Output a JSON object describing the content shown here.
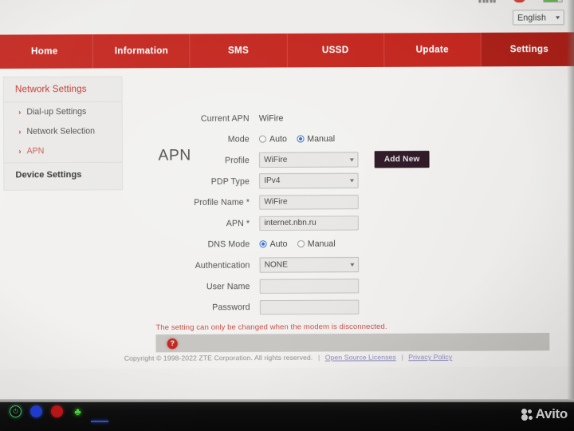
{
  "statusbar": {
    "signal_icon": "signal-bars-icon",
    "sim_icon": "sim-card-icon",
    "battery_icon": "battery-icon"
  },
  "language": {
    "selected": "English",
    "caret_icon": "chevron-down-icon"
  },
  "nav": {
    "tabs": [
      {
        "label": "Home",
        "active": false
      },
      {
        "label": "Information",
        "active": false
      },
      {
        "label": "SMS",
        "active": false
      },
      {
        "label": "USSD",
        "active": false
      },
      {
        "label": "Update",
        "active": false
      },
      {
        "label": "Settings",
        "active": true
      }
    ]
  },
  "sidebar": {
    "title": "Network Settings",
    "items": [
      {
        "label": "Dial-up Settings",
        "chevron": "›",
        "current": false
      },
      {
        "label": "Network Selection",
        "chevron": "›",
        "current": false
      },
      {
        "label": "APN",
        "chevron": "›",
        "current": true
      }
    ],
    "group_label": "Device Settings"
  },
  "page": {
    "title": "APN"
  },
  "form": {
    "current_apn": {
      "label": "Current APN",
      "value": "WiFire"
    },
    "mode": {
      "label": "Mode",
      "options": [
        {
          "label": "Auto",
          "selected": false
        },
        {
          "label": "Manual",
          "selected": true
        }
      ]
    },
    "profile": {
      "label": "Profile",
      "value": "WiFire",
      "caret_icon": "chevron-down-icon",
      "add_new_label": "Add New"
    },
    "pdp_type": {
      "label": "PDP Type",
      "value": "IPv4",
      "caret_icon": "chevron-down-icon"
    },
    "profile_name": {
      "label": "Profile Name",
      "required_mark": "*",
      "value": "WiFire",
      "placeholder": ""
    },
    "apn": {
      "label": "APN",
      "required_mark": "*",
      "value": "internet.nbn.ru",
      "placeholder": ""
    },
    "dns_mode": {
      "label": "DNS Mode",
      "options": [
        {
          "label": "Auto",
          "selected": true
        },
        {
          "label": "Manual",
          "selected": false
        }
      ]
    },
    "authentication": {
      "label": "Authentication",
      "value": "NONE",
      "caret_icon": "chevron-down-icon"
    },
    "user_name": {
      "label": "User Name",
      "value": "",
      "placeholder": ""
    },
    "password": {
      "label": "Password",
      "value": "",
      "placeholder": ""
    }
  },
  "notice": {
    "text": "The setting can only be changed when the modem is disconnected.",
    "color": "#cf4a40"
  },
  "helpbar": {
    "icon_label": "?",
    "icon_name": "help-icon"
  },
  "footer": {
    "copyright": "Copyright © 1998-2022 ZTE Corporation. All rights reserved.",
    "sep1": "|",
    "link1": "Open Source Licenses",
    "sep2": "|",
    "link2": "Privacy Policy"
  },
  "taskbar": {
    "icons": [
      {
        "name": "power-indicator-icon",
        "glyph": "⏻"
      },
      {
        "name": "bluetooth-indicator-icon",
        "glyph": ""
      },
      {
        "name": "recording-indicator-icon",
        "glyph": ""
      },
      {
        "name": "leaf-indicator-icon",
        "glyph": "♣"
      }
    ],
    "watermark": "Avito"
  },
  "colors": {
    "brand_red": "#cf1f16",
    "active_tab_red": "#b6180f",
    "radio_blue": "#2f6fd0",
    "notice_red": "#cf4a40",
    "button_dark": "#2a1020"
  }
}
